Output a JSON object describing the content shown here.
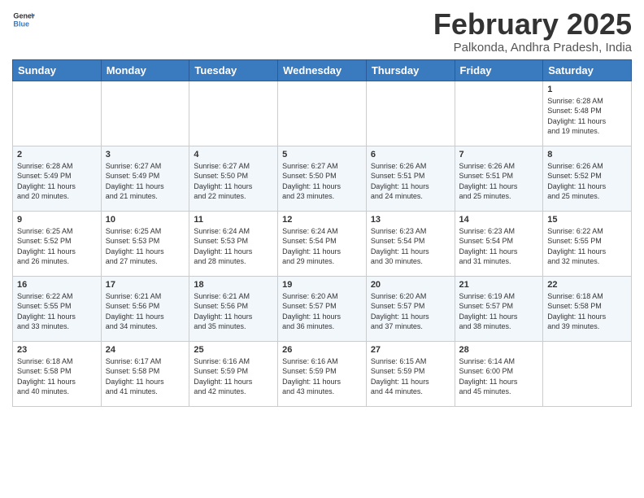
{
  "logo": {
    "line1": "General",
    "line2": "Blue"
  },
  "title": "February 2025",
  "subtitle": "Palkonda, Andhra Pradesh, India",
  "days_of_week": [
    "Sunday",
    "Monday",
    "Tuesday",
    "Wednesday",
    "Thursday",
    "Friday",
    "Saturday"
  ],
  "weeks": [
    [
      {
        "num": "",
        "info": ""
      },
      {
        "num": "",
        "info": ""
      },
      {
        "num": "",
        "info": ""
      },
      {
        "num": "",
        "info": ""
      },
      {
        "num": "",
        "info": ""
      },
      {
        "num": "",
        "info": ""
      },
      {
        "num": "1",
        "info": "Sunrise: 6:28 AM\nSunset: 5:48 PM\nDaylight: 11 hours\nand 19 minutes."
      }
    ],
    [
      {
        "num": "2",
        "info": "Sunrise: 6:28 AM\nSunset: 5:49 PM\nDaylight: 11 hours\nand 20 minutes."
      },
      {
        "num": "3",
        "info": "Sunrise: 6:27 AM\nSunset: 5:49 PM\nDaylight: 11 hours\nand 21 minutes."
      },
      {
        "num": "4",
        "info": "Sunrise: 6:27 AM\nSunset: 5:50 PM\nDaylight: 11 hours\nand 22 minutes."
      },
      {
        "num": "5",
        "info": "Sunrise: 6:27 AM\nSunset: 5:50 PM\nDaylight: 11 hours\nand 23 minutes."
      },
      {
        "num": "6",
        "info": "Sunrise: 6:26 AM\nSunset: 5:51 PM\nDaylight: 11 hours\nand 24 minutes."
      },
      {
        "num": "7",
        "info": "Sunrise: 6:26 AM\nSunset: 5:51 PM\nDaylight: 11 hours\nand 25 minutes."
      },
      {
        "num": "8",
        "info": "Sunrise: 6:26 AM\nSunset: 5:52 PM\nDaylight: 11 hours\nand 25 minutes."
      }
    ],
    [
      {
        "num": "9",
        "info": "Sunrise: 6:25 AM\nSunset: 5:52 PM\nDaylight: 11 hours\nand 26 minutes."
      },
      {
        "num": "10",
        "info": "Sunrise: 6:25 AM\nSunset: 5:53 PM\nDaylight: 11 hours\nand 27 minutes."
      },
      {
        "num": "11",
        "info": "Sunrise: 6:24 AM\nSunset: 5:53 PM\nDaylight: 11 hours\nand 28 minutes."
      },
      {
        "num": "12",
        "info": "Sunrise: 6:24 AM\nSunset: 5:54 PM\nDaylight: 11 hours\nand 29 minutes."
      },
      {
        "num": "13",
        "info": "Sunrise: 6:23 AM\nSunset: 5:54 PM\nDaylight: 11 hours\nand 30 minutes."
      },
      {
        "num": "14",
        "info": "Sunrise: 6:23 AM\nSunset: 5:54 PM\nDaylight: 11 hours\nand 31 minutes."
      },
      {
        "num": "15",
        "info": "Sunrise: 6:22 AM\nSunset: 5:55 PM\nDaylight: 11 hours\nand 32 minutes."
      }
    ],
    [
      {
        "num": "16",
        "info": "Sunrise: 6:22 AM\nSunset: 5:55 PM\nDaylight: 11 hours\nand 33 minutes."
      },
      {
        "num": "17",
        "info": "Sunrise: 6:21 AM\nSunset: 5:56 PM\nDaylight: 11 hours\nand 34 minutes."
      },
      {
        "num": "18",
        "info": "Sunrise: 6:21 AM\nSunset: 5:56 PM\nDaylight: 11 hours\nand 35 minutes."
      },
      {
        "num": "19",
        "info": "Sunrise: 6:20 AM\nSunset: 5:57 PM\nDaylight: 11 hours\nand 36 minutes."
      },
      {
        "num": "20",
        "info": "Sunrise: 6:20 AM\nSunset: 5:57 PM\nDaylight: 11 hours\nand 37 minutes."
      },
      {
        "num": "21",
        "info": "Sunrise: 6:19 AM\nSunset: 5:57 PM\nDaylight: 11 hours\nand 38 minutes."
      },
      {
        "num": "22",
        "info": "Sunrise: 6:18 AM\nSunset: 5:58 PM\nDaylight: 11 hours\nand 39 minutes."
      }
    ],
    [
      {
        "num": "23",
        "info": "Sunrise: 6:18 AM\nSunset: 5:58 PM\nDaylight: 11 hours\nand 40 minutes."
      },
      {
        "num": "24",
        "info": "Sunrise: 6:17 AM\nSunset: 5:58 PM\nDaylight: 11 hours\nand 41 minutes."
      },
      {
        "num": "25",
        "info": "Sunrise: 6:16 AM\nSunset: 5:59 PM\nDaylight: 11 hours\nand 42 minutes."
      },
      {
        "num": "26",
        "info": "Sunrise: 6:16 AM\nSunset: 5:59 PM\nDaylight: 11 hours\nand 43 minutes."
      },
      {
        "num": "27",
        "info": "Sunrise: 6:15 AM\nSunset: 5:59 PM\nDaylight: 11 hours\nand 44 minutes."
      },
      {
        "num": "28",
        "info": "Sunrise: 6:14 AM\nSunset: 6:00 PM\nDaylight: 11 hours\nand 45 minutes."
      },
      {
        "num": "",
        "info": ""
      }
    ]
  ]
}
